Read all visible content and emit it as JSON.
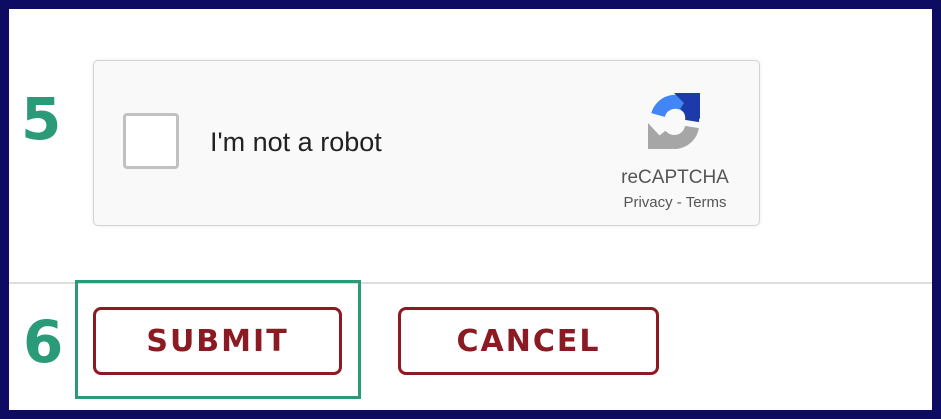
{
  "steps": {
    "captcha_step": "5",
    "submit_step": "6"
  },
  "recaptcha": {
    "checkbox_label": "I'm not a robot",
    "brand": "reCAPTCHA",
    "privacy_link": "Privacy",
    "separator": " - ",
    "terms_link": "Terms",
    "checked": false,
    "logo_icon": "recaptcha-logo-icon"
  },
  "actions": {
    "submit_label": "SUBMIT",
    "cancel_label": "CANCEL"
  },
  "colors": {
    "frame_border": "#0e0b63",
    "step_number": "#2a9a78",
    "highlight_border": "#2a9a78",
    "button_accent": "#8b1a22",
    "recaptcha_blue": "#1c3aa9",
    "recaptcha_light_blue": "#4285f4",
    "recaptcha_gray": "#a6a6a6"
  }
}
